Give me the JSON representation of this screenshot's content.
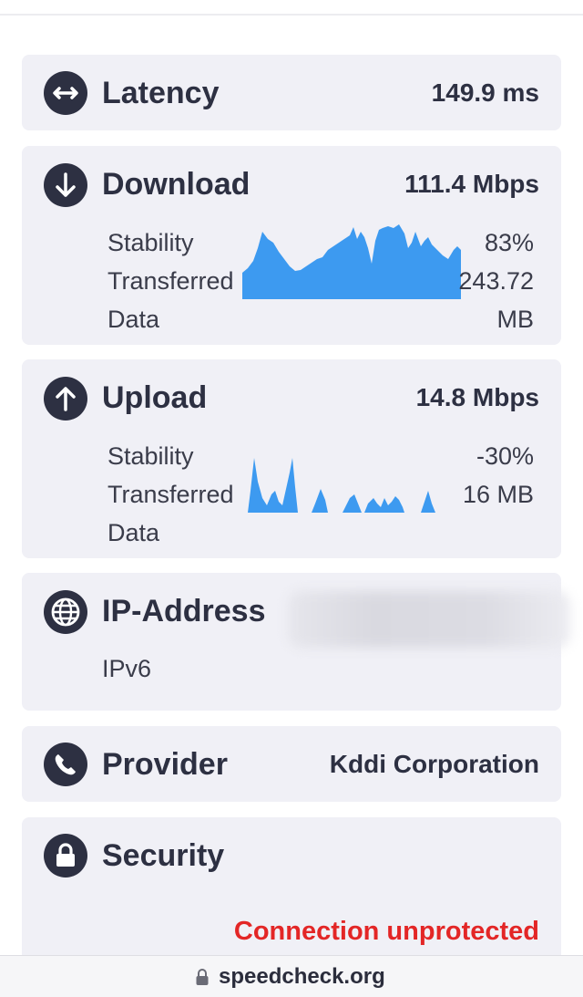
{
  "latency": {
    "title": "Latency",
    "value": "149.9 ms"
  },
  "download": {
    "title": "Download",
    "value": "111.4 Mbps",
    "stat_labels": [
      "Stability",
      "Transferred",
      "Data"
    ],
    "stability_value": "83%",
    "transferred_value": "243.72",
    "data_unit": "MB",
    "graph_color": "#3d9af0"
  },
  "upload": {
    "title": "Upload",
    "value": "14.8 Mbps",
    "stat_labels": [
      "Stability",
      "Transferred",
      "Data"
    ],
    "stability_value": "-30%",
    "transferred_value": "16 MB",
    "graph_color": "#3d9af0"
  },
  "ip": {
    "title": "IP-Address",
    "type": "IPv6"
  },
  "provider": {
    "title": "Provider",
    "value": "Kddi Corporation"
  },
  "security": {
    "title": "Security",
    "status": "Connection unprotected",
    "status_color": "#e32626"
  },
  "footer": {
    "domain": "speedcheck.org"
  },
  "icons": {
    "latency": "arrows-horizontal-icon",
    "download": "arrow-down-icon",
    "upload": "arrow-up-icon",
    "ip": "globe-icon",
    "provider": "phone-icon",
    "security": "lock-icon",
    "footer": "lock-icon"
  }
}
